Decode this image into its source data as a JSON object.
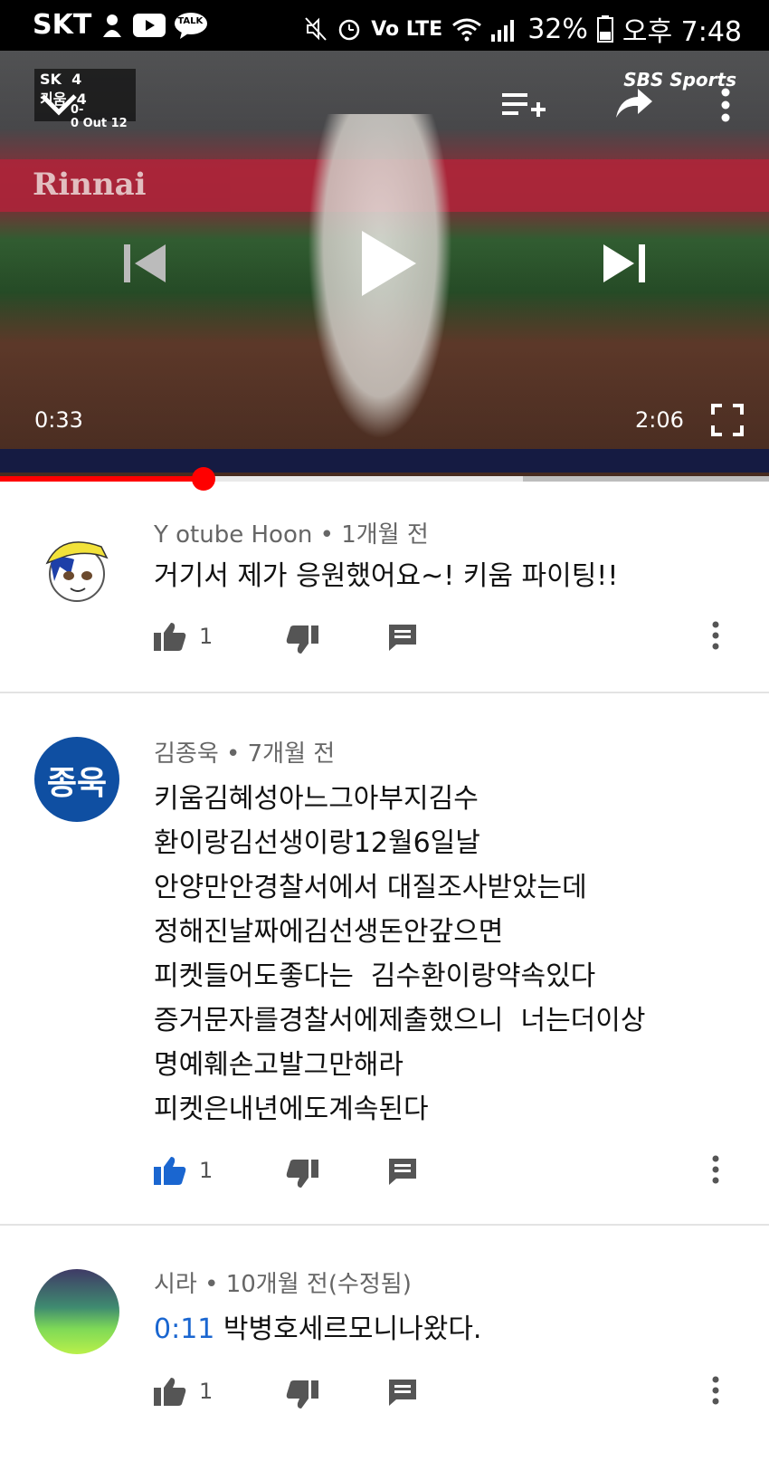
{
  "status_bar": {
    "carrier": "SKT",
    "talk_badge": "TALK",
    "network": "Vo LTE",
    "battery": "32%",
    "time": "오후 7:48"
  },
  "player": {
    "scoreboard": {
      "team1": "SK",
      "score1": "4",
      "team2": "키움",
      "score2": "4",
      "count": "0-0",
      "out_label": "Out",
      "inning": "12"
    },
    "banner_text": "Rinnai",
    "sponsor_text": "SBS Sports",
    "current_time": "0:33",
    "duration": "2:06",
    "progress": 0.265,
    "buffered": 0.68
  },
  "comments": [
    {
      "author": "Y otube Hoon",
      "age": "1개월 전",
      "lines": [
        "거기서 제가 응원했어요~! 키움 파이팅!!"
      ],
      "likes": "1",
      "liked": false,
      "avatar": "cartoon-avatar"
    },
    {
      "author": "김종욱",
      "age": "7개월 전",
      "avatar_text": "종욱",
      "lines": [
        "키움김혜성아느그아부지김수",
        "환이랑김선생이랑12월6일날",
        "안양만안경찰서에서 대질조사받았는데",
        "정해진날짜에김선생돈안갚으면",
        "피켓들어도좋다는  김수환이랑약속있다",
        "증거문자를경찰서에제출했으니  너는더이상",
        "명예훼손고발그만해라",
        "피켓은내년에도계속된다"
      ],
      "likes": "1",
      "liked": true
    },
    {
      "author": "시라",
      "age": "10개월 전(수정됨)",
      "timestamp": "0:11",
      "text": "박병호세르모니나왔다.",
      "likes": "1",
      "liked": false
    }
  ],
  "colors": {
    "accent_red": "#ff0000",
    "link_blue": "#1a66d0",
    "like_blue": "#1a66d0"
  }
}
